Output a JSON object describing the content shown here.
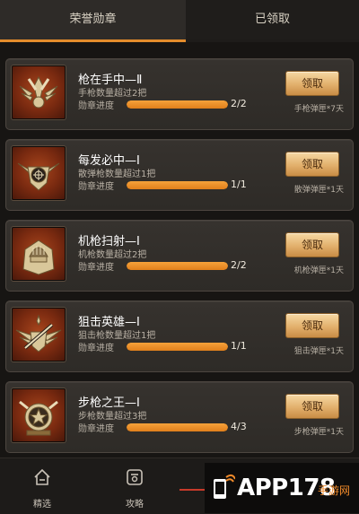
{
  "tabs": {
    "honor_medals": "荣誉勋章",
    "claimed": "已领取"
  },
  "medals": [
    {
      "title": "枪在手中—Ⅱ",
      "desc": "手枪数量超过2把",
      "progress_label": "勋章进度",
      "count": "2/2",
      "progress": 1.0,
      "claim": "领取",
      "reward": "手枪弹匣*7天",
      "icon": "pistol-wings-medal-icon"
    },
    {
      "title": "每发必中—Ⅰ",
      "desc": "散弹枪数量超过1把",
      "progress_label": "勋章进度",
      "count": "1/1",
      "progress": 1.0,
      "claim": "领取",
      "reward": "散弹弹匣*1天",
      "icon": "crosshair-medal-icon"
    },
    {
      "title": "机枪扫射—Ⅰ",
      "desc": "机枪数量超过2把",
      "progress_label": "勋章进度",
      "count": "2/2",
      "progress": 1.0,
      "claim": "领取",
      "reward": "机枪弹匣*1天",
      "icon": "helmet-medal-icon"
    },
    {
      "title": "狙击英雄—Ⅰ",
      "desc": "狙击枪数量超过1把",
      "progress_label": "勋章进度",
      "count": "1/1",
      "progress": 1.0,
      "claim": "领取",
      "reward": "狙击弹匣*1天",
      "icon": "sniper-wings-medal-icon"
    },
    {
      "title": "步枪之王—Ⅰ",
      "desc": "步枪数量超过3把",
      "progress_label": "勋章进度",
      "count": "4/3",
      "progress": 1.0,
      "claim": "领取",
      "reward": "步枪弹匣*1天",
      "icon": "rifle-star-medal-icon"
    }
  ],
  "bottom_nav": {
    "featured": "精选",
    "guide": "攻略"
  },
  "watermark": {
    "brand": "APP178",
    "site": "手游网"
  },
  "colors": {
    "accent": "#e48c2c",
    "progress": "#f29a2e",
    "claim_button": "#e2b06c"
  }
}
